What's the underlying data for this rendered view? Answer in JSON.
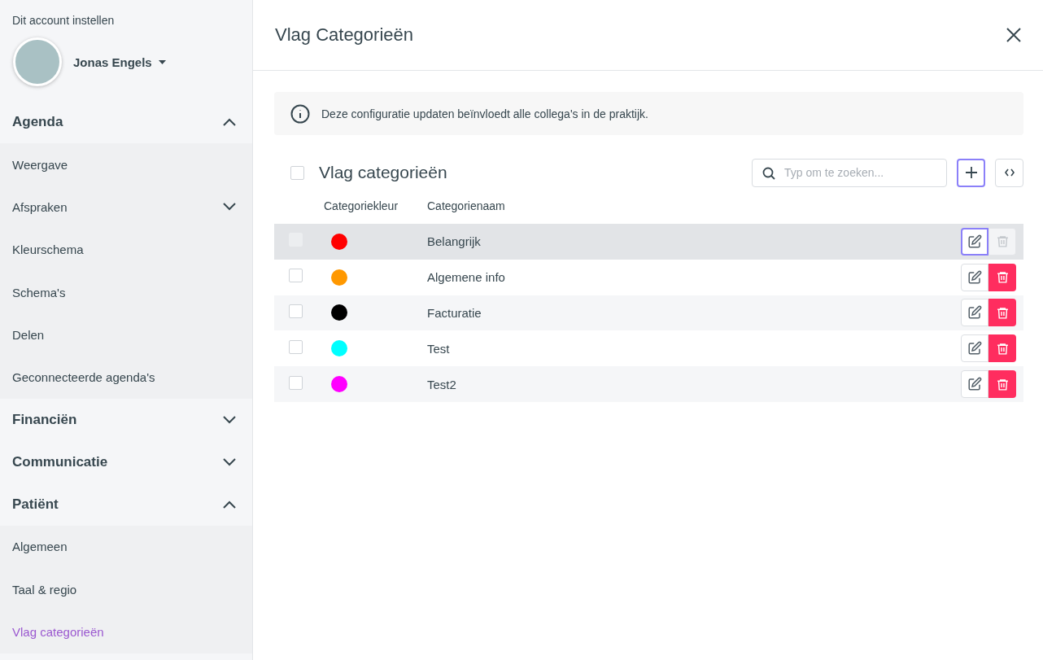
{
  "sidebar": {
    "caption": "Dit account instellen",
    "user": {
      "name": "Jonas Engels"
    },
    "sections": [
      {
        "title": "Agenda",
        "expanded": true,
        "items": [
          {
            "label": "Weergave",
            "selected": false
          },
          {
            "label": "Afspraken",
            "selected": false,
            "expanded": false
          },
          {
            "label": "Kleurschema",
            "selected": false
          },
          {
            "label": "Schema's",
            "selected": false
          },
          {
            "label": "Delen",
            "selected": false
          },
          {
            "label": "Geconnecteerde agenda's",
            "selected": false
          }
        ]
      },
      {
        "title": "Financiën",
        "expanded": false
      },
      {
        "title": "Communicatie",
        "expanded": false
      },
      {
        "title": "Patiënt",
        "expanded": true,
        "items": [
          {
            "label": "Algemeen",
            "selected": false
          },
          {
            "label": "Taal & regio",
            "selected": false
          },
          {
            "label": "Vlag categorieën",
            "selected": true
          }
        ]
      }
    ]
  },
  "panel": {
    "title": "Vlag Categorieën",
    "notice": "Deze configuratie updaten beïnvloedt alle collega's in de praktijk.",
    "list_title": "Vlag categorieën",
    "all_checked": false,
    "search": {
      "placeholder": "Typ om te zoeken..."
    },
    "columns": [
      "Categoriekleur",
      "Categorienaam"
    ],
    "rows": [
      {
        "name": "Belangrijk",
        "color": "#ff0000",
        "highlighted": true,
        "checked": false
      },
      {
        "name": "Algemene info",
        "color": "#ff9800",
        "highlighted": false,
        "checked": false
      },
      {
        "name": "Facturatie",
        "color": "#000000",
        "highlighted": false,
        "checked": false
      },
      {
        "name": "Test",
        "color": "#00ffff",
        "highlighted": false,
        "checked": false
      },
      {
        "name": "Test2",
        "color": "#ff00ff",
        "highlighted": false,
        "checked": false
      }
    ]
  }
}
